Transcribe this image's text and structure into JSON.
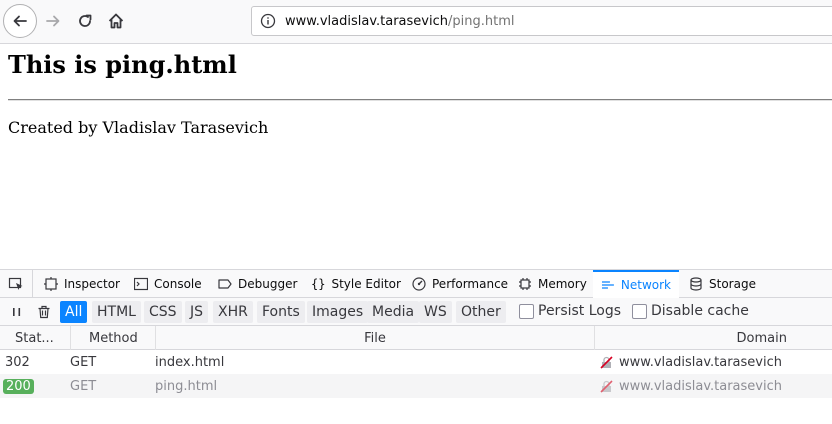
{
  "browser": {
    "url_host": "www.vladislav.tarasevich",
    "url_path": "/ping.html"
  },
  "page": {
    "heading": "This is ping.html",
    "created": "Created by Vladislav Tarasevich"
  },
  "devtools": {
    "tabs": [
      {
        "label": "Inspector",
        "icon": "inspector-icon"
      },
      {
        "label": "Console",
        "icon": "console-icon"
      },
      {
        "label": "Debugger",
        "icon": "debugger-icon"
      },
      {
        "label": "Style Editor",
        "icon": "style-editor-icon"
      },
      {
        "label": "Performance",
        "icon": "performance-icon"
      },
      {
        "label": "Memory",
        "icon": "memory-icon"
      },
      {
        "label": "Network",
        "icon": "network-icon",
        "selected": true
      },
      {
        "label": "Storage",
        "icon": "storage-icon"
      }
    ],
    "filters": [
      "All",
      "HTML",
      "CSS",
      "JS",
      "XHR",
      "Fonts",
      "Images",
      "Media",
      "WS",
      "Other"
    ],
    "active_filter": "All",
    "persist_logs": "Persist Logs",
    "disable_cache": "Disable cache",
    "columns": {
      "status": "Stat...",
      "method": "Method",
      "file": "File",
      "domain": "Domain"
    },
    "requests": [
      {
        "status": "302",
        "method": "GET",
        "file": "index.html",
        "domain": "www.vladislav.tarasevich"
      },
      {
        "status": "200",
        "method": "GET",
        "file": "ping.html",
        "domain": "www.vladislav.tarasevich"
      }
    ],
    "colors": {
      "accent": "#0a84ff",
      "status_ok": "#58b05c"
    }
  }
}
